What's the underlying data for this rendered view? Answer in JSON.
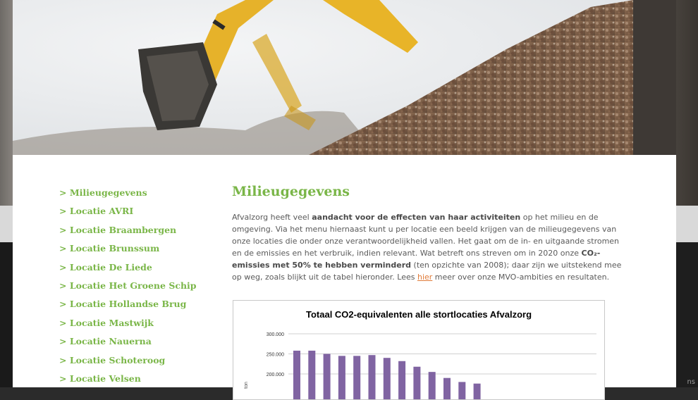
{
  "corner_text": "ns",
  "sidebar": {
    "items": [
      {
        "label": "> Milieugegevens"
      },
      {
        "label": "> Locatie AVRI"
      },
      {
        "label": "> Locatie Braambergen"
      },
      {
        "label": "> Locatie Brunssum"
      },
      {
        "label": "> Locatie De Liede"
      },
      {
        "label": "> Locatie Het Groene Schip"
      },
      {
        "label": "> Locatie Hollandse Brug"
      },
      {
        "label": "> Locatie Mastwijk"
      },
      {
        "label": "> Locatie Nauerna"
      },
      {
        "label": "> Locatie Schoteroog"
      },
      {
        "label": "> Locatie Velsen"
      }
    ]
  },
  "main": {
    "title": "Milieugegevens",
    "intro": {
      "p1": "Afvalzorg heeft veel ",
      "b1": "aandacht voor de effecten van haar activiteiten",
      "p2": " op het milieu en de omgeving. Via het menu hiernaast kunt u per locatie een beeld krijgen van de milieugegevens van onze locaties die onder onze verantwoordelijkheid vallen. Het gaat om de in- en uitgaande stromen en de emissies en het verbruik, indien relevant.  Wat betreft ons streven om in 2020 onze ",
      "b2": "CO₂-emissies met 50% te hebben verminderd",
      "p3": " (ten opzichte van 2008); daar zijn we uitstekend mee op weg, zoals blijkt uit de tabel hieronder. Lees ",
      "link": "hier",
      "p4": " meer over onze MVO-ambities en resultaten."
    }
  },
  "chart_data": {
    "type": "bar",
    "title": "Totaal CO2-equivalenten alle stortlocaties Afvalzorg",
    "ylabel": "ton",
    "yticks": [
      "300.000",
      "250.000",
      "200.000"
    ],
    "ylim": [
      0,
      300000
    ],
    "values": [
      258000,
      258000,
      250000,
      245000,
      245000,
      247000,
      240000,
      232000,
      218000,
      205000,
      190000,
      180000,
      176000
    ],
    "color": "#8064a2"
  },
  "colors": {
    "accent_green": "#7ab648",
    "link_orange": "#e07b39",
    "body_text": "#5a5a5a"
  }
}
